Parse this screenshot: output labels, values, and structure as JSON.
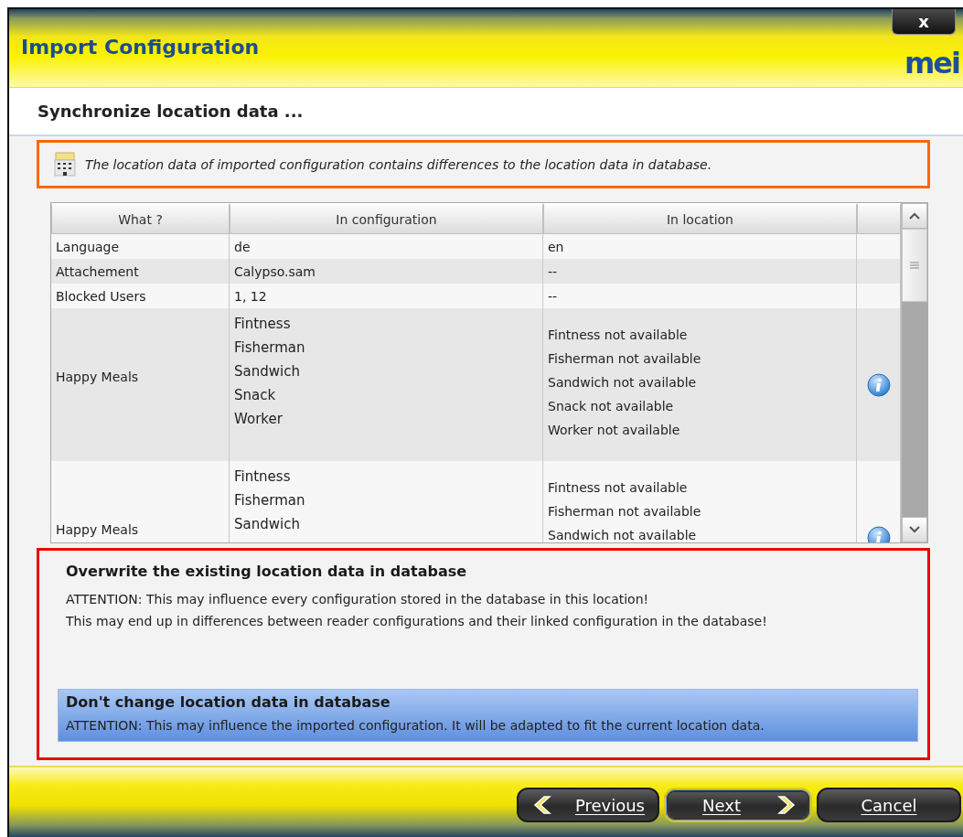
{
  "window": {
    "title": "Import Configuration",
    "close": "x",
    "logo": "mei"
  },
  "subtitle": "Synchronize location data ...",
  "notice": "The location data of imported configuration contains differences to the location data in database.",
  "table": {
    "columns": [
      "What ?",
      "In configuration",
      "In location"
    ],
    "rows": [
      {
        "kind": "simple",
        "what": "Language",
        "configuration": [
          "de"
        ],
        "location": [
          "en"
        ],
        "info": false
      },
      {
        "kind": "simple",
        "what": "Attachement",
        "configuration": [
          "Calypso.sam"
        ],
        "location": [
          "--"
        ],
        "info": false
      },
      {
        "kind": "simple",
        "what": "Blocked Users",
        "configuration": [
          "1, 12"
        ],
        "location": [
          "--"
        ],
        "info": false
      },
      {
        "kind": "list",
        "what": "Happy Meals",
        "configuration": [
          "Fintness",
          "Fisherman",
          "Sandwich",
          "Snack",
          "Worker"
        ],
        "location": [
          "Fintness not available",
          "Fisherman  not available",
          "Sandwich not available",
          "Snack not available",
          "Worker not available"
        ],
        "info": true
      },
      {
        "kind": "list",
        "what": "Happy Meals",
        "configuration": [
          "Fintness",
          "Fisherman",
          "Sandwich"
        ],
        "location": [
          "Fintness not available",
          "Fisherman  not available",
          "Sandwich not available"
        ],
        "info": true
      }
    ]
  },
  "options": [
    {
      "title": "Overwrite the existing location data in database",
      "lines": [
        "ATTENTION: This may influence every configuration stored in the database in this location!",
        "This may end up in differences between reader configurations and their linked configuration in the database!"
      ],
      "selected": false
    },
    {
      "title": "Don't change location data in database",
      "lines": [
        "ATTENTION: This may influence the imported configuration. It will be adapted to fit the current location data."
      ],
      "selected": true
    }
  ],
  "buttons": [
    {
      "label": "Previous",
      "kind": "back",
      "default": false
    },
    {
      "label": "Next",
      "kind": "forward",
      "default": true
    },
    {
      "label": "Cancel",
      "kind": "plain",
      "default": false
    }
  ]
}
